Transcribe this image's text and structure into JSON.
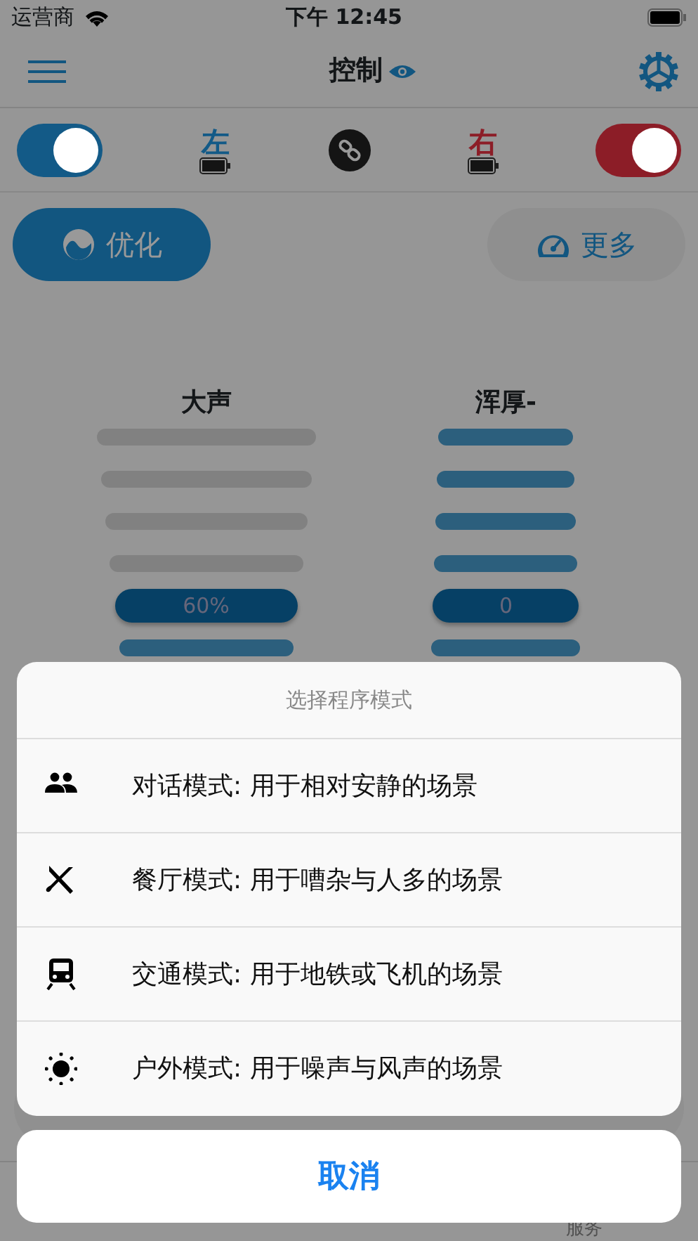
{
  "status_bar": {
    "carrier": "运营商",
    "time": "下午 12:45"
  },
  "nav": {
    "title": "控制"
  },
  "devices": [
    {
      "label": "左",
      "on": true,
      "color": "#135a87"
    },
    {
      "label": "右",
      "on": true,
      "color": "#8c1d27"
    }
  ],
  "modes": [
    {
      "label": "优化",
      "selected": true
    },
    {
      "label": "更多",
      "selected": false
    }
  ],
  "columns": [
    {
      "title": "大声",
      "value": "60%",
      "bars_above": [
        {
          "active": false
        },
        {
          "active": false
        },
        {
          "active": false
        },
        {
          "active": false
        }
      ],
      "bars_below": [
        {
          "active": true
        }
      ]
    },
    {
      "title": "浑厚-",
      "value": "0",
      "bars_above": [
        {
          "active": true
        },
        {
          "active": true
        },
        {
          "active": true
        },
        {
          "active": true
        }
      ],
      "bars_below": [
        {
          "active": true
        }
      ]
    }
  ],
  "tabs": [
    {
      "label": "服务",
      "selected": false
    }
  ],
  "sheet": {
    "title": "选择程序模式",
    "options": [
      {
        "kind": "people",
        "label": "对话模式: 用于相对安静的场景"
      },
      {
        "kind": "dining",
        "label": "餐厅模式: 用于嘈杂与人多的场景"
      },
      {
        "kind": "train",
        "label": "交通模式: 用于地铁或飞机的场景"
      },
      {
        "kind": "sun",
        "label": "户外模式: 用于噪声与风声的场景"
      }
    ],
    "cancel": "取消"
  }
}
